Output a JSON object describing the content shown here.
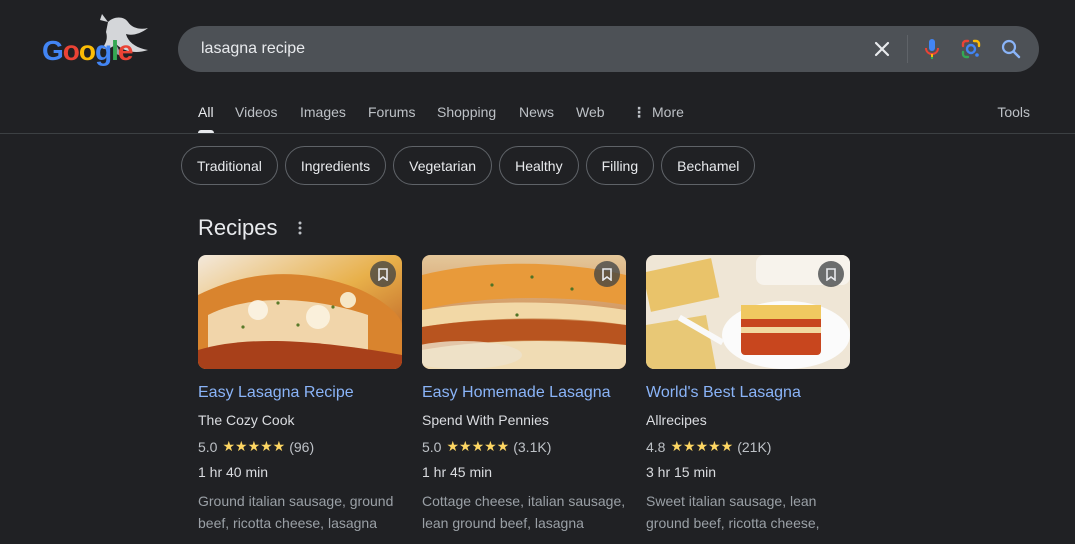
{
  "logo": {
    "letters": [
      "G",
      "o",
      "o",
      "g",
      "l",
      "e"
    ],
    "colors": [
      "#4285f4",
      "#ea4335",
      "#fbbc05",
      "#4285f4",
      "#34a853",
      "#ea4335"
    ]
  },
  "search": {
    "query": "lasagna recipe",
    "clear_icon": "close-icon",
    "mic_icon": "microphone-icon",
    "lens_icon": "google-lens-icon",
    "search_icon": "search-icon"
  },
  "tabs": {
    "items": [
      {
        "label": "All",
        "active": true
      },
      {
        "label": "Videos"
      },
      {
        "label": "Images"
      },
      {
        "label": "Forums"
      },
      {
        "label": "Shopping"
      },
      {
        "label": "News"
      },
      {
        "label": "Web"
      }
    ],
    "more_label": "More",
    "tools_label": "Tools"
  },
  "chips": [
    "Traditional",
    "Ingredients",
    "Vegetarian",
    "Healthy",
    "Filling",
    "Bechamel"
  ],
  "recipes": {
    "title": "Recipes",
    "cards": [
      {
        "title": "Easy Lasagna Recipe",
        "source": "The Cozy Cook",
        "rating": "5.0",
        "stars": "★★★★★",
        "reviews": "(96)",
        "time": "1 hr 40 min",
        "description": "Ground italian sausage, ground beef, ricotta cheese, lasagna"
      },
      {
        "title": "Easy Homemade Lasagna",
        "source": "Spend With Pennies",
        "rating": "5.0",
        "stars": "★★★★★",
        "reviews": "(3.1K)",
        "time": "1 hr 45 min",
        "description": "Cottage cheese, italian sausage, lean ground beef, lasagna"
      },
      {
        "title": "World's Best Lasagna",
        "source": "Allrecipes",
        "rating": "4.8",
        "stars": "★★★★★",
        "reviews": "(21K)",
        "time": "3 hr 15 min",
        "description": "Sweet italian sausage, lean ground beef, ricotta cheese,"
      }
    ]
  },
  "colors": {
    "background": "#202124",
    "search_bar": "#4d5156",
    "link": "#8ab4f8",
    "star": "#fdd663"
  }
}
